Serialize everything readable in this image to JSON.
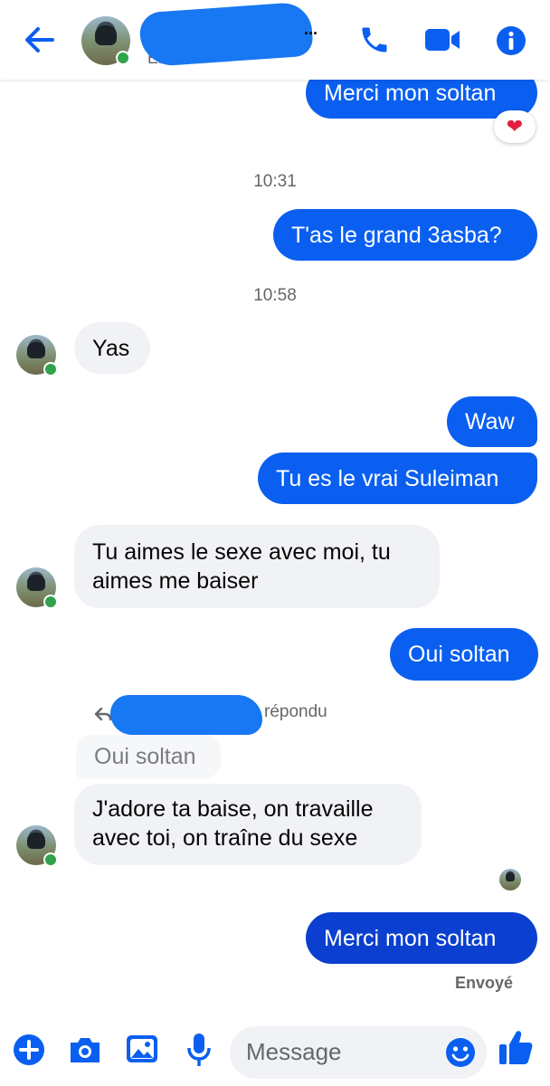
{
  "header": {
    "status_fragment": "En",
    "more_glyph": "...",
    "icons": [
      "back-arrow-icon",
      "phone-icon",
      "video-camera-icon",
      "info-icon"
    ]
  },
  "messages": [
    {
      "id": "m1",
      "side": "out",
      "text": "Merci mon soltan",
      "reaction": "❤"
    },
    {
      "id": "t1",
      "type": "time",
      "text": "10:31"
    },
    {
      "id": "m2",
      "side": "out",
      "text": "T'as le grand 3asba?"
    },
    {
      "id": "t2",
      "type": "time",
      "text": "10:58"
    },
    {
      "id": "m3",
      "side": "in",
      "text": "Yas"
    },
    {
      "id": "m4",
      "side": "out",
      "text": "Waw"
    },
    {
      "id": "m5",
      "side": "out",
      "text": "Tu es le vrai Suleiman"
    },
    {
      "id": "m6",
      "side": "in",
      "lines": [
        "Tu aimes le sexe avec moi, tu",
        "aimes me baiser"
      ]
    },
    {
      "id": "m7",
      "side": "out",
      "text": "Oui soltan"
    },
    {
      "id": "r1",
      "type": "reply_header",
      "text": "répondu"
    },
    {
      "id": "q1",
      "type": "quoted",
      "text": "Oui soltan"
    },
    {
      "id": "m8",
      "side": "in",
      "lines": [
        "J'adore ta baise, on travaille",
        "avec toi, on traîne du sexe"
      ]
    },
    {
      "id": "m9",
      "side": "out",
      "text": "Merci mon soltan",
      "status": "Envoyé"
    }
  ],
  "composer": {
    "placeholder": "Message",
    "icons": [
      "plus-icon",
      "camera-icon",
      "gallery-icon",
      "microphone-icon",
      "emoji-icon",
      "thumbs-up-icon"
    ]
  },
  "colors": {
    "accent": "#0a5ff0",
    "accent_dark": "#0a3fd0",
    "incoming_bubble": "#f0f2f5",
    "online": "#31a24c",
    "heart": "#e41e3f"
  }
}
